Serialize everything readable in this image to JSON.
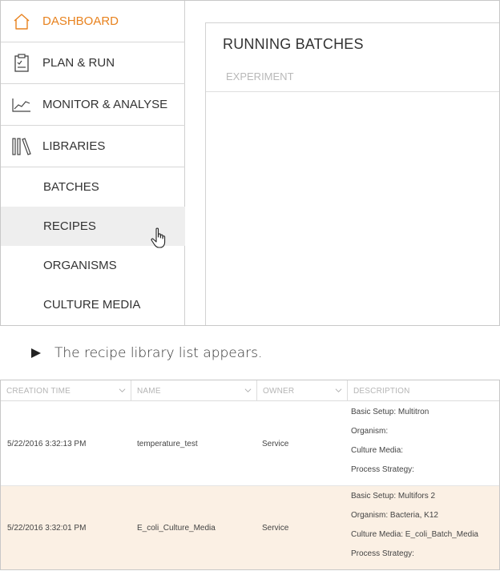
{
  "sidebar": {
    "nav": [
      {
        "label": "DASHBOARD",
        "icon": "home-icon",
        "active": true
      },
      {
        "label": "PLAN & RUN",
        "icon": "clipboard-icon",
        "active": false
      },
      {
        "label": "MONITOR & ANALYSE",
        "icon": "chart-line-icon",
        "active": false
      },
      {
        "label": "LIBRARIES",
        "icon": "books-icon",
        "active": false
      }
    ],
    "sub_items": [
      {
        "label": "BATCHES"
      },
      {
        "label": "RECIPES",
        "hover": true
      },
      {
        "label": "ORGANISMS"
      },
      {
        "label": "CULTURE MEDIA"
      }
    ]
  },
  "main": {
    "title": "RUNNING BATCHES",
    "column": "EXPERIMENT"
  },
  "caption": {
    "text": "The recipe library list appears."
  },
  "table": {
    "headers": [
      "CREATION TIME",
      "NAME",
      "OWNER",
      "DESCRIPTION"
    ],
    "rows": [
      {
        "creation_time": "5/22/2016 3:32:13 PM",
        "name": "temperature_test",
        "owner": "Service",
        "description": [
          "Basic Setup: Multitron",
          "Organism:",
          "Culture Media:",
          "Process Strategy:"
        ]
      },
      {
        "creation_time": "5/22/2016 3:32:01 PM",
        "name": "E_coli_Culture_Media",
        "owner": "Service",
        "description": [
          "Basic Setup: Multifors 2",
          "Organism: Bacteria, K12",
          "Culture Media: E_coli_Batch_Media",
          "Process Strategy:"
        ]
      }
    ]
  },
  "colors": {
    "accent": "#e8821e",
    "hover_bg": "#eeeeee",
    "selected_row_bg": "#fbf0e4"
  }
}
